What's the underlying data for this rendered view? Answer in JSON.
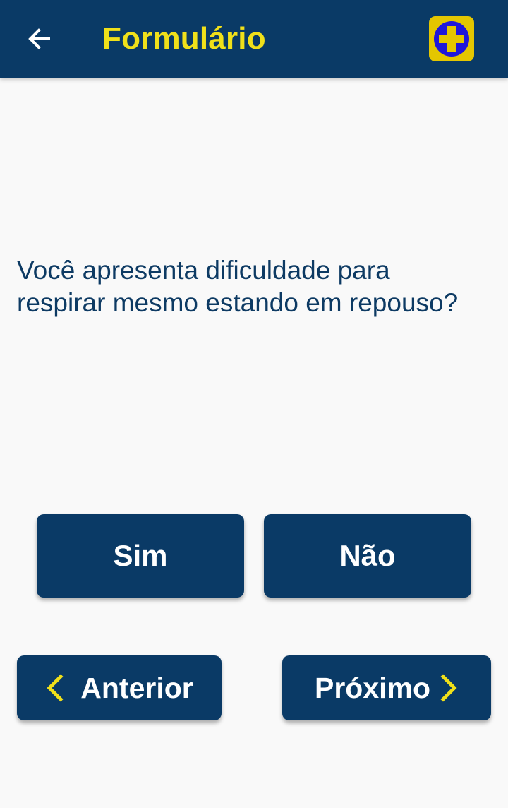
{
  "appbar": {
    "title": "Formulário",
    "back_icon": "arrow-left-icon",
    "logo_icon": "medical-cross-icon",
    "colors": {
      "background": "#0a3a66",
      "title": "#f0e01a",
      "logo_bg": "#e4c600",
      "logo_circle": "#1f16d9"
    }
  },
  "question": {
    "text": "Você apresenta dificuldade para respirar mesmo estando em repouso?"
  },
  "answers": {
    "yes_label": "Sim",
    "no_label": "Não"
  },
  "navigation": {
    "previous_label": "Anterior",
    "next_label": "Próximo",
    "previous_icon": "chevron-left-icon",
    "next_icon": "chevron-right-icon",
    "chevron_color": "#f0e01a"
  }
}
